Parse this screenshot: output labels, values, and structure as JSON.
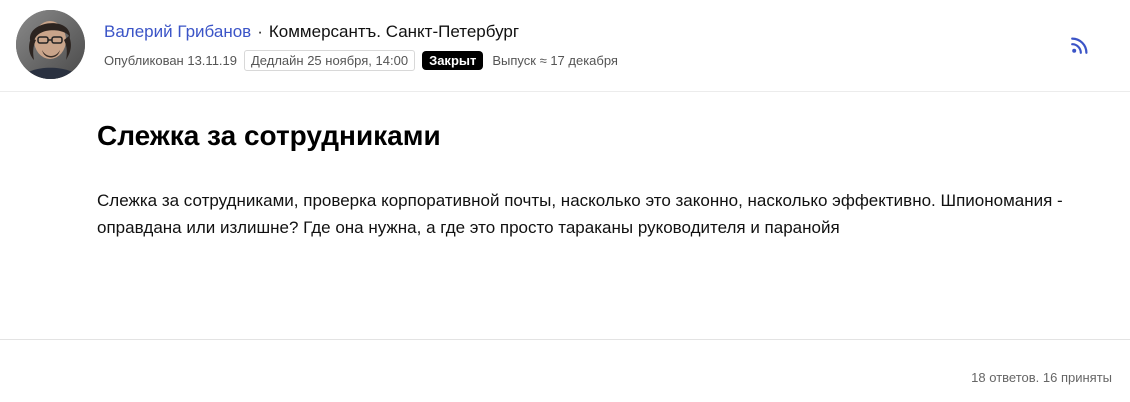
{
  "header": {
    "author_name": "Валерий Грибанов",
    "separator": "·",
    "publication": "Коммерсантъ. Санкт-Петербург",
    "published_label": "Опубликован 13.11.19",
    "deadline_label": "Дедлайн 25 ноября, 14:00",
    "status_label": "Закрыт",
    "release_label": "Выпуск ≈ 17 декабря",
    "rss_icon": "rss-icon",
    "colors": {
      "author_link": "#3b54c7",
      "status_badge_bg": "#000000",
      "rss_icon": "#3b54c7"
    }
  },
  "main": {
    "title": "Слежка за сотрудниками",
    "body": "Слежка за сотрудниками, проверка корпоративной почты, насколько это законно, насколько эффективно. Шпиономания - оправдана или излишне? Где она нужна, а где это просто тараканы руководителя и паранойя"
  },
  "footer": {
    "stats": "18 ответов. 16 приняты"
  }
}
